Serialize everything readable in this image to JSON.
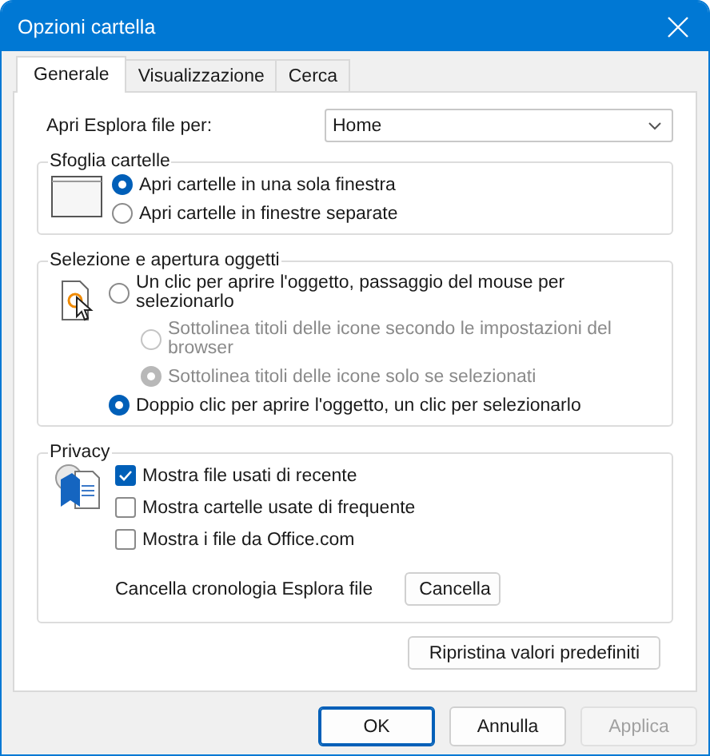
{
  "window": {
    "title": "Opzioni cartella"
  },
  "tabs": [
    {
      "label": "Generale",
      "selected": true
    },
    {
      "label": "Visualizzazione",
      "selected": false
    },
    {
      "label": "Cerca",
      "selected": false
    }
  ],
  "open_explorer": {
    "label": "Apri Esplora file per:",
    "value": "Home"
  },
  "browse_group": {
    "title": "Sfoglia cartelle",
    "options": [
      {
        "label": "Apri cartelle in una sola finestra",
        "selected": true,
        "disabled": false
      },
      {
        "label": "Apri cartelle in finestre separate",
        "selected": false,
        "disabled": false
      }
    ]
  },
  "click_group": {
    "title": "Selezione e apertura oggetti",
    "options": [
      {
        "label": "Un clic per aprire l'oggetto, passaggio del mouse per selezionarlo",
        "selected": false,
        "disabled": false,
        "children": [
          {
            "label": "Sottolinea titoli delle icone secondo le impostazioni del browser",
            "selected": false,
            "disabled": true
          },
          {
            "label": "Sottolinea titoli delle icone solo se selezionati",
            "selected": true,
            "disabled": true
          }
        ]
      },
      {
        "label": "Doppio clic per aprire l'oggetto, un clic per selezionarlo",
        "selected": true,
        "disabled": false
      }
    ]
  },
  "privacy_group": {
    "title": "Privacy",
    "checkboxes": [
      {
        "label": "Mostra file usati di recente",
        "checked": true
      },
      {
        "label": "Mostra cartelle usate di frequente",
        "checked": false
      },
      {
        "label": "Mostra i file da Office.com",
        "checked": false
      }
    ],
    "clear_label": "Cancella cronologia Esplora file",
    "clear_button": "Cancella"
  },
  "restore_button": "Ripristina valori predefiniti",
  "buttons": [
    {
      "label": "OK",
      "default": true,
      "disabled": false
    },
    {
      "label": "Annulla",
      "default": false,
      "disabled": false
    },
    {
      "label": "Applica",
      "default": false,
      "disabled": true
    }
  ]
}
